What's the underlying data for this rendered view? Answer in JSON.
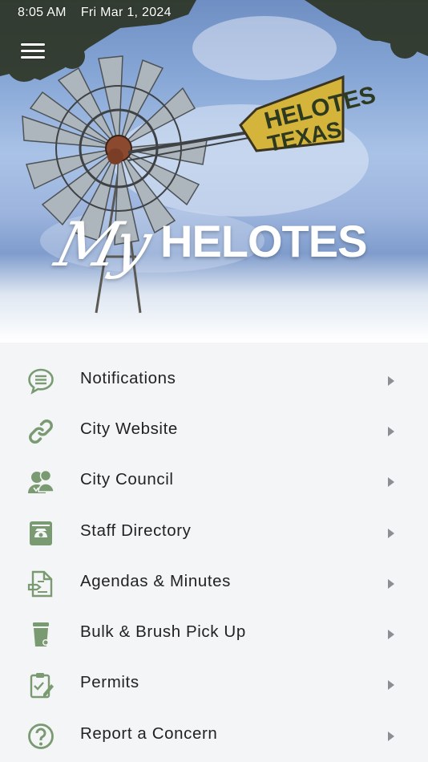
{
  "status": {
    "time": "8:05 AM",
    "date": "Fri Mar 1, 2024"
  },
  "brand": {
    "script": "My",
    "name": "HELOTES"
  },
  "sign": {
    "line1": "HELOTES",
    "line2": "TEXAS"
  },
  "colors": {
    "icon": "#7a9a72",
    "chevron": "#8a8f94",
    "text": "#222222",
    "background": "#f4f5f7"
  },
  "menu": {
    "items": [
      {
        "label": "Notifications",
        "icon": "chat-list-icon"
      },
      {
        "label": "City Website",
        "icon": "link-icon"
      },
      {
        "label": "City Council",
        "icon": "people-icon"
      },
      {
        "label": "Staff Directory",
        "icon": "phone-book-icon"
      },
      {
        "label": "Agendas & Minutes",
        "icon": "document-icon"
      },
      {
        "label": "Bulk & Brush Pick Up",
        "icon": "trash-can-icon"
      },
      {
        "label": "Permits",
        "icon": "clipboard-check-icon"
      },
      {
        "label": "Report a Concern",
        "icon": "question-circle-icon"
      }
    ]
  }
}
